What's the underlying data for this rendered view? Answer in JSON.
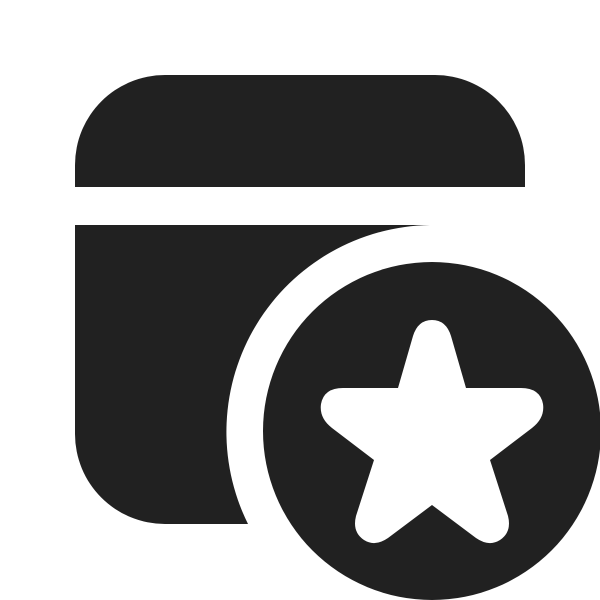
{
  "icon": {
    "name": "calendar-star-icon",
    "fill_color": "#212121",
    "background_color": "#ffffff",
    "star_color": "#ffffff"
  }
}
